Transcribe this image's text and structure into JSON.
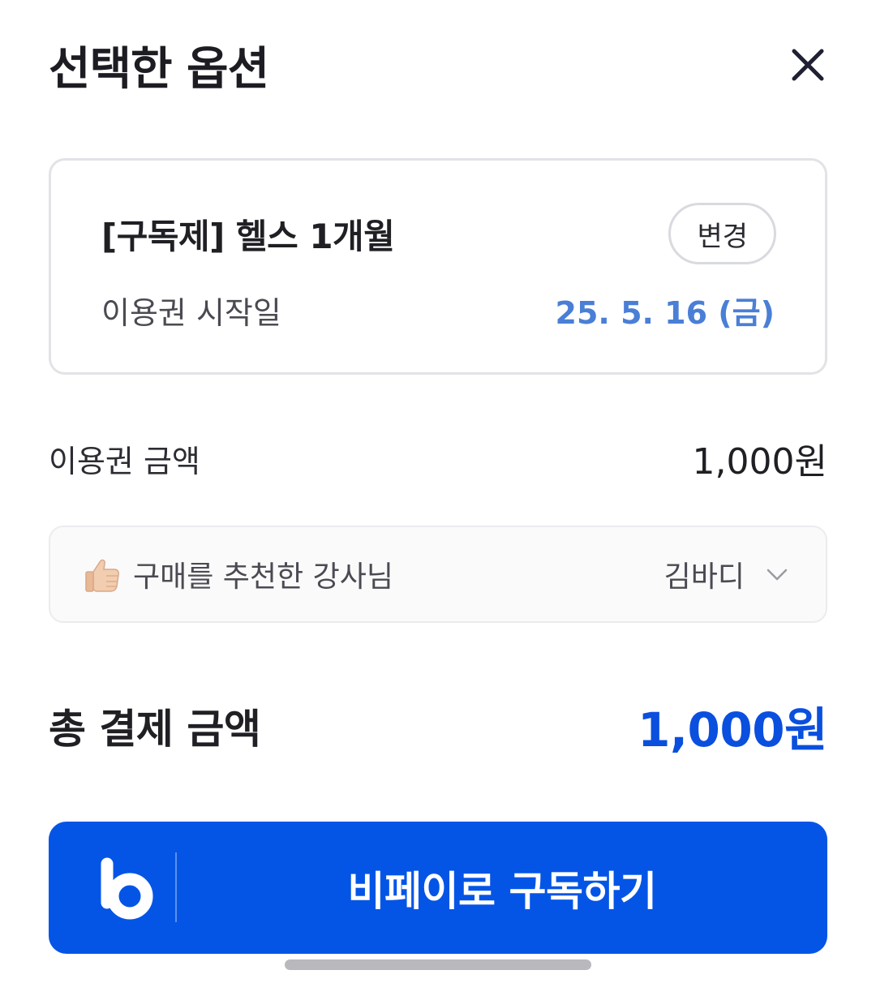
{
  "header": {
    "title": "선택한 옵션",
    "close_icon": "close-icon"
  },
  "option_card": {
    "product_name": "[구독제] 헬스 1개월",
    "change_label": "변경",
    "start_label": "이용권 시작일",
    "start_value": "25. 5. 16 (금)",
    "start_value_color": "#4a7fd6"
  },
  "price": {
    "label": "이용권 금액",
    "value": "1,000원"
  },
  "instructor": {
    "icon": "thumbs-up-icon",
    "label": "구매를 추천한 강사님",
    "value": "김바디",
    "chevron_icon": "chevron-down-icon"
  },
  "total": {
    "label": "총 결제 금액",
    "value": "1,000원",
    "color": "#0a4fde"
  },
  "pay_button": {
    "logo_icon": "bpay-logo-icon",
    "label": "비페이로 구독하기",
    "background": "#0455e6"
  }
}
